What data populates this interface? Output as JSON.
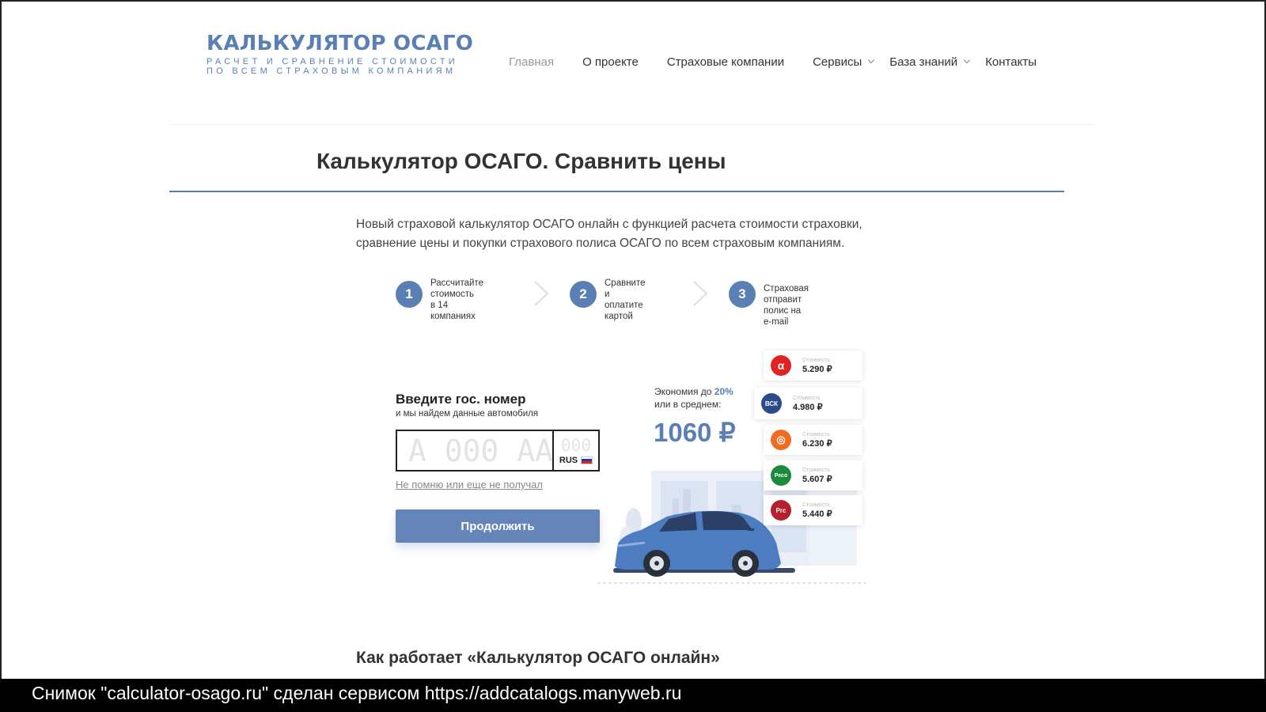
{
  "logo": {
    "title": "КАЛЬКУЛЯТОР ОСАГО",
    "subtitle_line1": "РАСЧЕТ И СРАВНЕНИЕ СТОИМОСТИ",
    "subtitle_line2": "ПО ВСЕМ СТРАХОВЫМ КОМПАНИЯМ"
  },
  "nav": {
    "items": [
      {
        "label": "Главная",
        "active": true
      },
      {
        "label": "О проекте"
      },
      {
        "label": "Страховые компании"
      },
      {
        "label": "Сервисы",
        "dropdown": true
      },
      {
        "label": "База знаний",
        "dropdown": true
      },
      {
        "label": "Контакты"
      }
    ]
  },
  "page": {
    "title": "Калькулятор ОСАГО. Сравнить цены",
    "intro_line1": "Новый страховой калькулятор ОСАГО онлайн с функцией расчета стоимости страховки,",
    "intro_line2": "сравнение цены и покупки страхового полиса ОСАГО по всем страховым компаниям."
  },
  "steps": [
    {
      "number": "1",
      "text": "Рассчитайте\nстоимость\nв 14 компаниях"
    },
    {
      "number": "2",
      "text": "Сравните и\nоплатите\nкартой"
    },
    {
      "number": "3",
      "text": "Страховая отправит\nполис на e-mail"
    }
  ],
  "form": {
    "title": "Введите гос. номер",
    "subtitle": "и мы найдем данные автомобиля",
    "plate_placeholder": "А 000 АА",
    "region_placeholder": "000",
    "country": "RUS",
    "forgot_link": "Не помню или еще не получал",
    "submit_label": "Продолжить"
  },
  "savings": {
    "line1_prefix": "Экономия до ",
    "percent": "20%",
    "line2": "или в среднем:",
    "amount": "1060 ₽"
  },
  "price_cards": [
    {
      "logo_text": "α",
      "logo_color": "#e32222",
      "label": "Стоимость",
      "price": "5.290 ₽"
    },
    {
      "logo_text": "ВСК",
      "logo_color": "#2d4a8a",
      "label": "Стоимость",
      "price": "4.980 ₽"
    },
    {
      "logo_text": "◎",
      "logo_color": "#f26b21",
      "label": "Стоимость",
      "price": "6.230 ₽"
    },
    {
      "logo_text": "Ресо",
      "logo_color": "#1a8a3c",
      "label": "Стоимость",
      "price": "5.607 ₽"
    },
    {
      "logo_text": "Ргс",
      "logo_color": "#b5202e",
      "label": "Стоимость",
      "price": "5.440 ₽"
    }
  ],
  "section": {
    "heading": "Как работает «Калькулятор ОСАГО онлайн»"
  },
  "footer_overlay": {
    "text": "Снимок \"calculator-osago.ru\" сделан сервисом https://addcatalogs.manyweb.ru"
  },
  "colors": {
    "accent": "#5a7fb5",
    "button": "#6585b8",
    "flag_white": "#ffffff",
    "flag_blue": "#1c3fae",
    "flag_red": "#d52b1e"
  }
}
